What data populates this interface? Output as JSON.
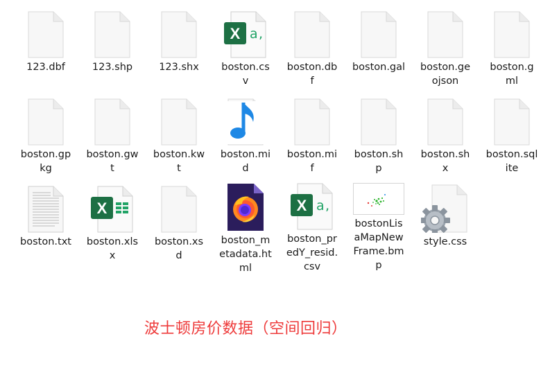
{
  "files": [
    {
      "name": "123.dbf",
      "icon": "blank-file-icon"
    },
    {
      "name": "123.shp",
      "icon": "blank-file-icon"
    },
    {
      "name": "123.shx",
      "icon": "blank-file-icon"
    },
    {
      "name": "boston.cs\nv",
      "icon": "excel-csv-icon"
    },
    {
      "name": "boston.db\nf",
      "icon": "blank-file-icon"
    },
    {
      "name": "boston.gal",
      "icon": "blank-file-icon"
    },
    {
      "name": "boston.ge\nojson",
      "icon": "blank-file-icon"
    },
    {
      "name": "boston.g\nml",
      "icon": "blank-file-icon"
    },
    {
      "name": "boston.gp\nkg",
      "icon": "blank-file-icon"
    },
    {
      "name": "boston.gw\nt",
      "icon": "blank-file-icon"
    },
    {
      "name": "boston.kw\nt",
      "icon": "blank-file-icon"
    },
    {
      "name": "boston.mi\nd",
      "icon": "music-note-icon"
    },
    {
      "name": "boston.mi\nf",
      "icon": "blank-file-icon"
    },
    {
      "name": "boston.sh\np",
      "icon": "blank-file-icon"
    },
    {
      "name": "boston.sh\nx",
      "icon": "blank-file-icon"
    },
    {
      "name": "boston.sql\nite",
      "icon": "blank-file-icon"
    },
    {
      "name": "boston.txt",
      "icon": "text-file-icon"
    },
    {
      "name": "boston.xls\nx",
      "icon": "excel-xlsx-icon"
    },
    {
      "name": "boston.xs\nd",
      "icon": "blank-file-icon"
    },
    {
      "name": "boston_m\netadata.ht\nml",
      "icon": "firefox-html-icon"
    },
    {
      "name": "boston_pr\nedY_resid.\ncsv",
      "icon": "excel-csv-icon"
    },
    {
      "name": "bostonLis\naMapNew\nFrame.bm\np",
      "icon": "bmp-thumbnail-icon"
    },
    {
      "name": "style.css",
      "icon": "gear-file-icon"
    }
  ],
  "caption": "波士顿房价数据（空间回归）",
  "colors": {
    "excel_green": "#1d7044",
    "csv_accent": "#21a366",
    "music_blue": "#1e88e5",
    "caption_red": "#ee3a3a"
  }
}
